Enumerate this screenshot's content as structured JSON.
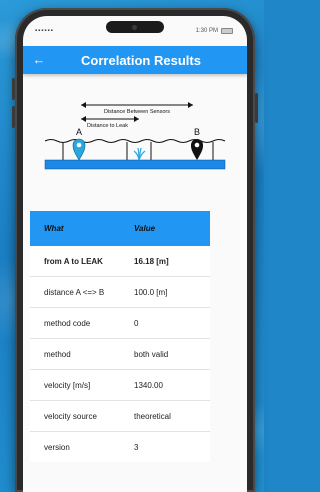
{
  "status": {
    "signal": "▪▪▪▪▪▪",
    "time": "1:30 PM"
  },
  "appbar": {
    "title": "Correlation Results"
  },
  "diagram": {
    "distance_between_label": "Distance Between Sensors",
    "distance_to_leak_label": "Distance to Leak",
    "sensor_a": "A",
    "sensor_b": "B"
  },
  "table": {
    "header": {
      "what": "What",
      "value": "Value"
    },
    "rows": [
      {
        "what": "from A to LEAK",
        "value": "16.18 [m]"
      },
      {
        "what": "distance A <=> B",
        "value": "100.0 [m]"
      },
      {
        "what": "method code",
        "value": "0"
      },
      {
        "what": "method",
        "value": "both valid"
      },
      {
        "what": "velocity [m/s]",
        "value": "1340.00"
      },
      {
        "what": "velocity source",
        "value": "theoretical"
      },
      {
        "what": "version",
        "value": "3"
      }
    ]
  },
  "colors": {
    "primary": "#2196f3",
    "pipe_blue": "#1e88e5"
  }
}
